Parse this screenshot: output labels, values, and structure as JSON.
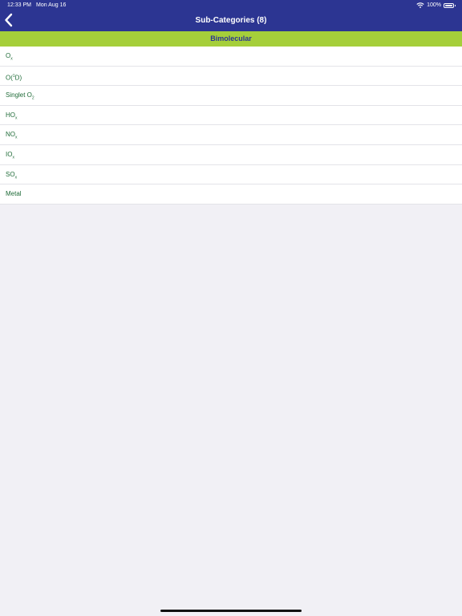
{
  "status_bar": {
    "time": "12:33 PM",
    "date": "Mon Aug 16",
    "battery": "100%"
  },
  "nav": {
    "title": "Sub-Categories (8)"
  },
  "section": {
    "title": "Bimolecular"
  },
  "items": [
    {
      "base": "O",
      "sub": "x",
      "sup": ""
    },
    {
      "base": "O(",
      "sup": "1",
      "rest": "D)"
    },
    {
      "base": "Singlet O",
      "sub": "2"
    },
    {
      "base": "HO",
      "sub": "x"
    },
    {
      "base": "NO",
      "sub": "x"
    },
    {
      "base": "IO",
      "sub": "x"
    },
    {
      "base": "SO",
      "sub": "x"
    },
    {
      "base": "Metal"
    }
  ],
  "colors": {
    "nav_bg": "#2c3592",
    "section_bg": "#a5cf3a",
    "item_text": "#1f6b38",
    "page_bg": "#f1f0f5"
  }
}
